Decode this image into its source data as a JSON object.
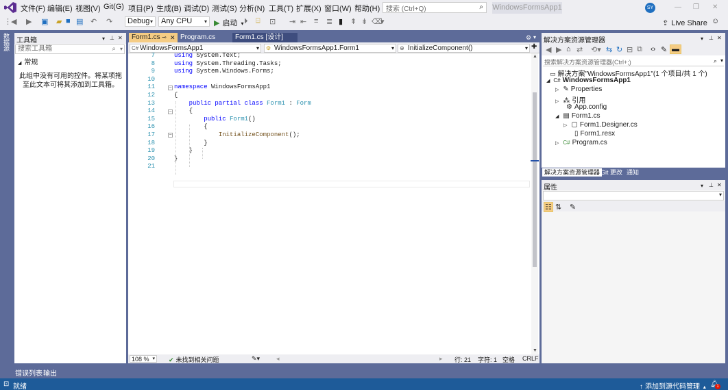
{
  "menu": [
    "文件(F)",
    "编辑(E)",
    "视图(V)",
    "Git(G)",
    "项目(P)",
    "生成(B)",
    "调试(D)",
    "测试(S)",
    "分析(N)",
    "工具(T)",
    "扩展(X)",
    "窗口(W)",
    "帮助(H)"
  ],
  "search": {
    "placeholder": "搜索 (Ctrl+Q)"
  },
  "app_title": "WindowsFormsApp1",
  "user_initials": "SY",
  "toolbar": {
    "config": "Debug",
    "platform": "Any CPU",
    "start_label": "启动",
    "live_share": "Live Share"
  },
  "left_strip": {
    "label": "数据源"
  },
  "toolbox": {
    "title": "工具箱",
    "search_placeholder": "搜索工具箱",
    "group": "常规",
    "empty_text": "此组中没有可用的控件。将某项拖至此文本可将其添加到工具箱。"
  },
  "editor": {
    "tabs": [
      {
        "label": "Form1.cs"
      },
      {
        "label": "Program.cs"
      },
      {
        "label": "Form1.cs [设计]"
      }
    ],
    "nav": {
      "project": "WindowsFormsApp1",
      "class": "WindowsFormsApp1.Form1",
      "member": "InitializeComponent()"
    },
    "lines": [
      {
        "n": "7",
        "tokens": [
          {
            "t": "using ",
            "c": "kw"
          },
          {
            "t": "System.Text;",
            "c": ""
          }
        ]
      },
      {
        "n": "8",
        "tokens": [
          {
            "t": "using ",
            "c": "kw"
          },
          {
            "t": "System.Threading.Tasks;",
            "c": ""
          }
        ]
      },
      {
        "n": "9",
        "tokens": [
          {
            "t": "using ",
            "c": "kw"
          },
          {
            "t": "System.Windows.Forms;",
            "c": ""
          }
        ]
      },
      {
        "n": "10",
        "tokens": []
      },
      {
        "n": "11",
        "tokens": [
          {
            "t": "namespace ",
            "c": "kw"
          },
          {
            "t": "WindowsFormsApp1",
            "c": ""
          }
        ]
      },
      {
        "n": "12",
        "tokens": [
          {
            "t": "{",
            "c": ""
          }
        ]
      },
      {
        "n": "13",
        "tokens": [
          {
            "t": "    public partial class ",
            "c": "kw"
          },
          {
            "t": "Form1",
            "c": "ty"
          },
          {
            "t": " : ",
            "c": ""
          },
          {
            "t": "Form",
            "c": "ty"
          }
        ]
      },
      {
        "n": "14",
        "tokens": [
          {
            "t": "    {",
            "c": ""
          }
        ]
      },
      {
        "n": "15",
        "tokens": [
          {
            "t": "        public ",
            "c": "kw"
          },
          {
            "t": "Form1",
            "c": "ty"
          },
          {
            "t": "()",
            "c": ""
          }
        ]
      },
      {
        "n": "16",
        "tokens": [
          {
            "t": "        {",
            "c": ""
          }
        ]
      },
      {
        "n": "17",
        "tokens": [
          {
            "t": "            ",
            "c": ""
          },
          {
            "t": "InitializeComponent",
            "c": "fn"
          },
          {
            "t": "();",
            "c": ""
          }
        ]
      },
      {
        "n": "18",
        "tokens": [
          {
            "t": "        }",
            "c": ""
          }
        ]
      },
      {
        "n": "19",
        "tokens": [
          {
            "t": "    }",
            "c": ""
          }
        ]
      },
      {
        "n": "20",
        "tokens": [
          {
            "t": "}",
            "c": ""
          }
        ]
      },
      {
        "n": "21",
        "tokens": []
      }
    ],
    "status": {
      "zoom": "108 %",
      "issues": "未找到相关问题",
      "line": "行: 21",
      "col": "字符: 1",
      "spaces": "空格",
      "eol": "CRLF"
    }
  },
  "solution_explorer": {
    "title": "解决方案资源管理器",
    "search_placeholder": "搜索解决方案资源管理器(Ctrl+;)",
    "items": [
      {
        "label": "解决方案\"WindowsFormsApp1\"(1 个项目/共 1 个)",
        "icon": "solution-icon"
      },
      {
        "label": "WindowsFormsApp1",
        "icon": "csharp-project-icon"
      },
      {
        "label": "Properties",
        "icon": "wrench-icon"
      },
      {
        "label": "引用",
        "icon": "references-icon"
      },
      {
        "label": "App.config",
        "icon": "config-file-icon"
      },
      {
        "label": "Form1.cs",
        "icon": "form-icon"
      },
      {
        "label": "Form1.Designer.cs",
        "icon": "csharp-file-icon"
      },
      {
        "label": "Form1.resx",
        "icon": "resx-file-icon"
      },
      {
        "label": "Program.cs",
        "icon": "csharp-file-icon"
      }
    ],
    "tabs": [
      "解决方案资源管理器",
      "Git 更改",
      "通知"
    ]
  },
  "properties": {
    "title": "属性"
  },
  "bottom_tabs": [
    "错误列表",
    "输出"
  ],
  "statusbar": {
    "ready": "就绪",
    "source_control": "添加到源代码管理",
    "notif_count": "1"
  },
  "colors": {
    "accent": "#5d6b99",
    "status_bar": "#1e5b99",
    "active_tab": "#f5cc84",
    "keyword": "#0000ff",
    "type": "#2b91af"
  }
}
